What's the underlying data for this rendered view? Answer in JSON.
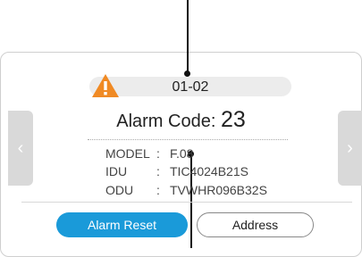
{
  "alarm": {
    "index_label": "01-02",
    "code_label": "Alarm Code:",
    "code_value": "23"
  },
  "info": {
    "model": {
      "key": "MODEL",
      "value": "F.08"
    },
    "idu": {
      "key": "IDU",
      "value": "TIC4024B21S"
    },
    "odu": {
      "key": "ODU",
      "value": "TVWHR096B32S"
    },
    "separator": ":"
  },
  "nav": {
    "prev_glyph": "‹",
    "next_glyph": "›"
  },
  "buttons": {
    "alarm_reset": "Alarm Reset",
    "address": "Address"
  },
  "colors": {
    "accent": "#1a9ad9",
    "warning": "#f08a24"
  }
}
